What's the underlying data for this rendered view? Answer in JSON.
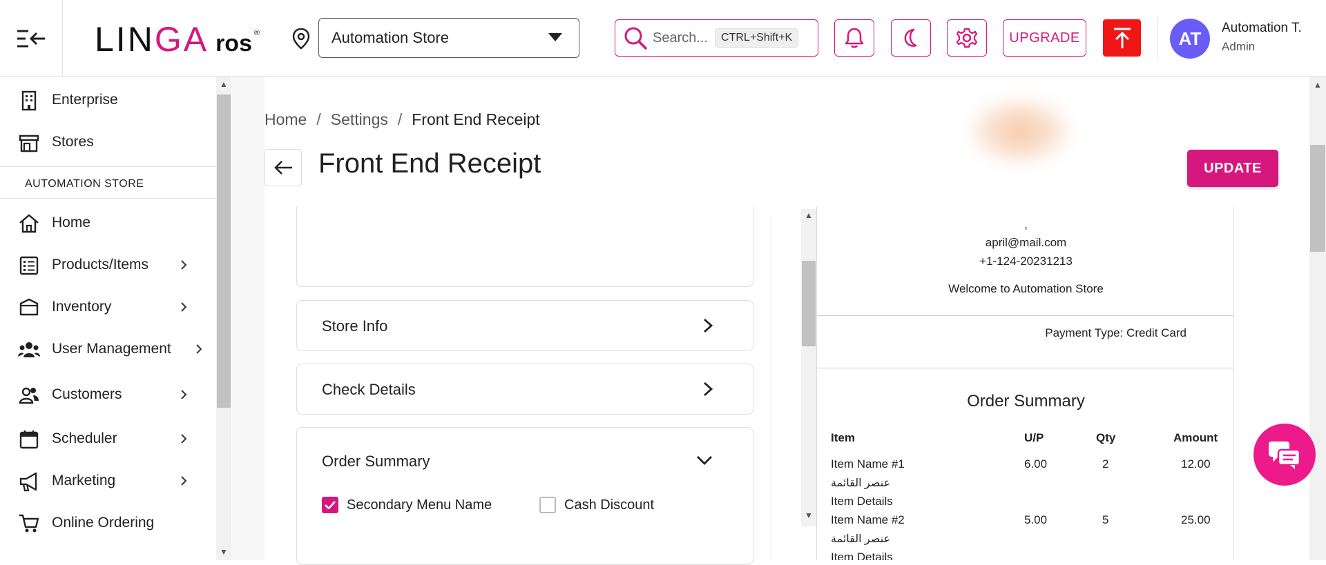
{
  "header": {
    "logo": {
      "part1": "LIN",
      "part2": "GA",
      "part3": "ros",
      "part4": "®"
    },
    "store": "Automation Store",
    "search": {
      "placeholder": "Search...",
      "shortcut": "CTRL+Shift+K"
    },
    "upgrade_label": "UPGRADE",
    "user": {
      "initials": "AT",
      "name": "Automation T.",
      "role": "Admin"
    }
  },
  "sidebar": {
    "top_items": [
      {
        "label": "Enterprise",
        "icon": "building-icon"
      },
      {
        "label": "Stores",
        "icon": "store-icon"
      }
    ],
    "section": "AUTOMATION STORE",
    "items": [
      {
        "label": "Home",
        "icon": "home-icon"
      },
      {
        "label": "Products/Items",
        "icon": "list-icon"
      },
      {
        "label": "Inventory",
        "icon": "box-icon"
      },
      {
        "label": "User Management",
        "icon": "users-icon"
      },
      {
        "label": "Customers",
        "icon": "customers-icon"
      },
      {
        "label": "Scheduler",
        "icon": "calendar-icon"
      },
      {
        "label": "Marketing",
        "icon": "megaphone-icon"
      },
      {
        "label": "Online Ordering",
        "icon": "cart-icon"
      }
    ]
  },
  "breadcrumb": {
    "home": "Home",
    "settings": "Settings",
    "current": "Front End Receipt"
  },
  "page": {
    "title": "Front End Receipt",
    "update_label": "UPDATE"
  },
  "settings": {
    "store_info": "Store Info",
    "check_details": "Check Details",
    "order_summary": "Order Summary",
    "checkboxes": [
      {
        "label": "Secondary Menu Name",
        "checked": true
      },
      {
        "label": "Cash Discount",
        "checked": false
      }
    ]
  },
  "receipt": {
    "comma": ",",
    "email": "april@mail.com",
    "phone": "+1-124-20231213",
    "welcome": "Welcome to Automation Store",
    "payment_label": "Payment Type:",
    "payment_value": "Credit Card",
    "summary_title": "Order Summary",
    "columns": {
      "item": "Item",
      "up": "U/P",
      "qty": "Qty",
      "amount": "Amount"
    },
    "rows": [
      {
        "name": "Item Name #1",
        "secondary": "عنصر القائمة",
        "details": "Item Details",
        "up": "6.00",
        "qty": "2",
        "amount": "12.00"
      },
      {
        "name": "Item Name #2",
        "secondary": "عنصر القائمة",
        "details": "Item Details",
        "up": "5.00",
        "qty": "5",
        "amount": "25.00"
      }
    ]
  }
}
